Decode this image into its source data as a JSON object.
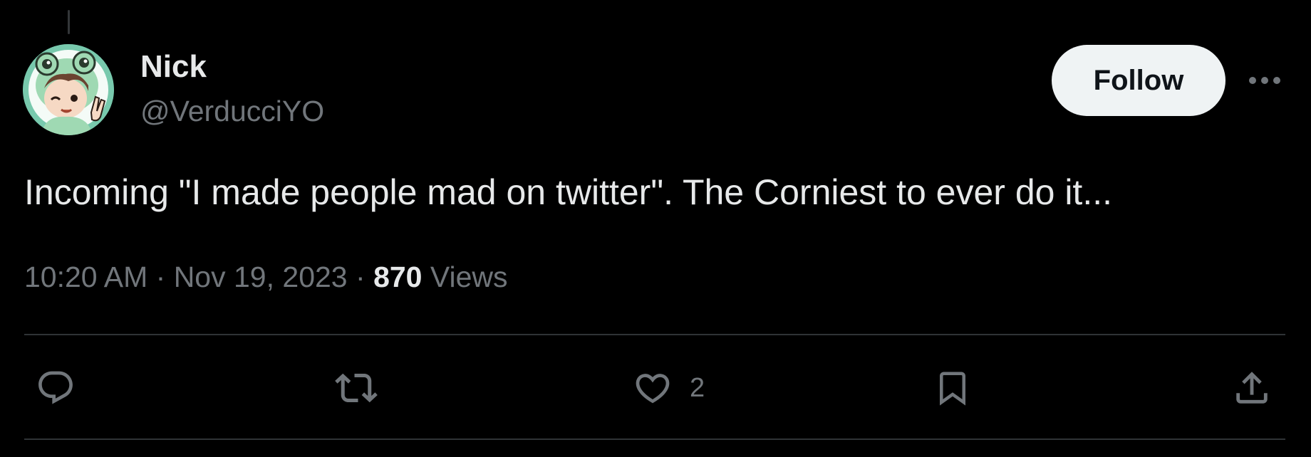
{
  "tweet": {
    "author": {
      "display_name": "Nick",
      "handle": "@VerducciYO",
      "avatar_icon": "avatar-frog-hood-character"
    },
    "follow_label": "Follow",
    "more_icon": "more-horizontal-icon",
    "text": "Incoming \"I made people mad on twitter\". The Corniest to ever do it...",
    "time": "10:20 AM",
    "separator": "·",
    "date": "Nov 19, 2023",
    "views_count": "870",
    "views_label": "Views"
  },
  "actions": {
    "reply": {
      "icon": "reply-icon",
      "count": ""
    },
    "repost": {
      "icon": "repost-icon",
      "count": ""
    },
    "like": {
      "icon": "heart-icon",
      "count": "2"
    },
    "bookmark": {
      "icon": "bookmark-icon",
      "count": ""
    },
    "share": {
      "icon": "share-icon",
      "count": ""
    }
  },
  "colors": {
    "background": "#000000",
    "primary_text": "#e7e9ea",
    "secondary_text": "#71767b",
    "divider": "#2f3336",
    "follow_button_bg": "#eff3f4",
    "follow_button_text": "#0f1419"
  }
}
